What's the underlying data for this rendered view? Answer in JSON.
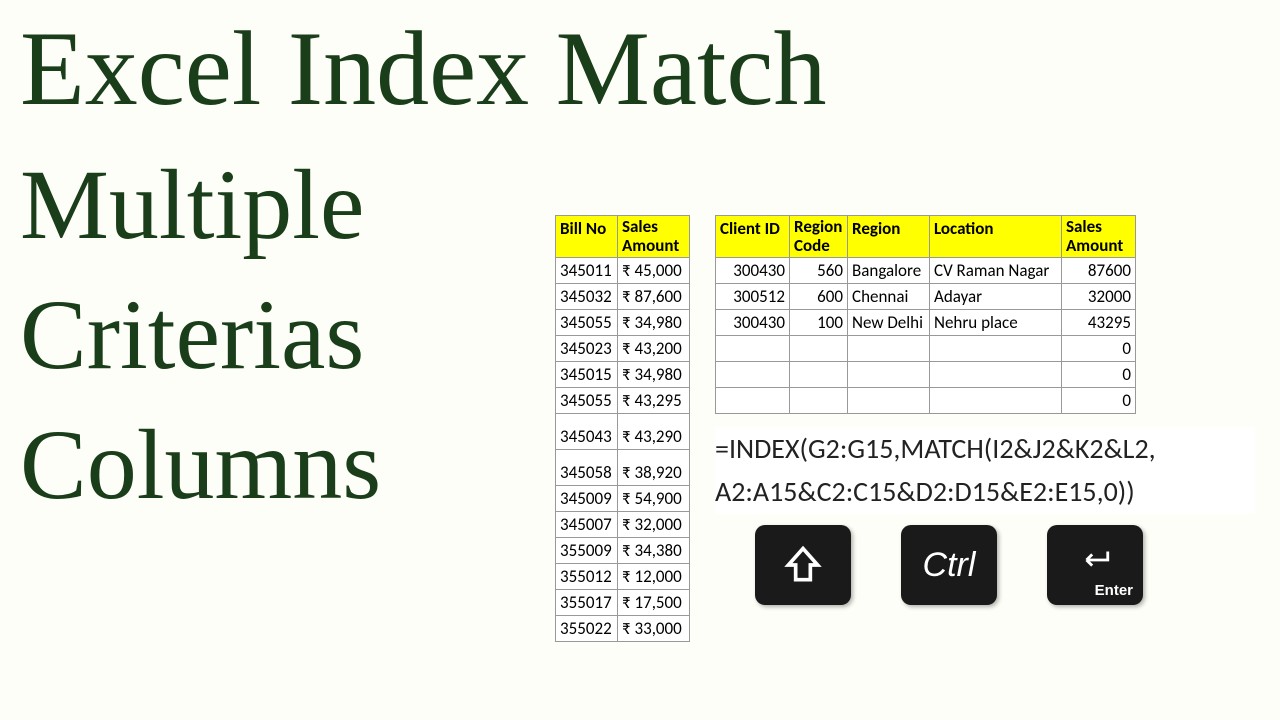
{
  "title": {
    "line1": "Excel Index Match",
    "line2": "Multiple",
    "line3": "Criterias",
    "line4": "Columns"
  },
  "left_table": {
    "headers": [
      "Bill No",
      "Sales Amount"
    ],
    "rows": [
      [
        "345011",
        "₹ 45,000"
      ],
      [
        "345032",
        "₹ 87,600"
      ],
      [
        "345055",
        "₹ 34,980"
      ],
      [
        "345023",
        "₹ 43,200"
      ],
      [
        "345015",
        "₹ 34,980"
      ],
      [
        "345055",
        "₹ 43,295"
      ],
      [
        "345043",
        "₹ 43,290"
      ],
      [
        "345058",
        "₹ 38,920"
      ],
      [
        "345009",
        "₹ 54,900"
      ],
      [
        "345007",
        "₹ 32,000"
      ],
      [
        "355009",
        "₹ 34,380"
      ],
      [
        "355012",
        "₹ 12,000"
      ],
      [
        "355017",
        "₹ 17,500"
      ],
      [
        "355022",
        "₹ 33,000"
      ]
    ]
  },
  "right_table": {
    "headers": [
      "Client ID",
      "Region Code",
      "Region",
      "Location",
      "Sales Amount"
    ],
    "rows": [
      [
        "300430",
        "560",
        "Bangalore",
        "CV Raman Nagar",
        "87600"
      ],
      [
        "300512",
        "600",
        "Chennai",
        "Adayar",
        "32000"
      ],
      [
        "300430",
        "100",
        "New Delhi",
        "Nehru place",
        "43295"
      ],
      [
        "",
        "",
        "",
        "",
        "0"
      ],
      [
        "",
        "",
        "",
        "",
        "0"
      ],
      [
        "",
        "",
        "",
        "",
        "0"
      ]
    ]
  },
  "formula": {
    "line1": "=INDEX(G2:G15,MATCH(I2&J2&K2&L2,",
    "line2": "A2:A15&C2:C15&D2:D15&E2:E15,0))"
  },
  "keys": {
    "shift": "Shift",
    "ctrl": "Ctrl",
    "enter": "Enter"
  }
}
